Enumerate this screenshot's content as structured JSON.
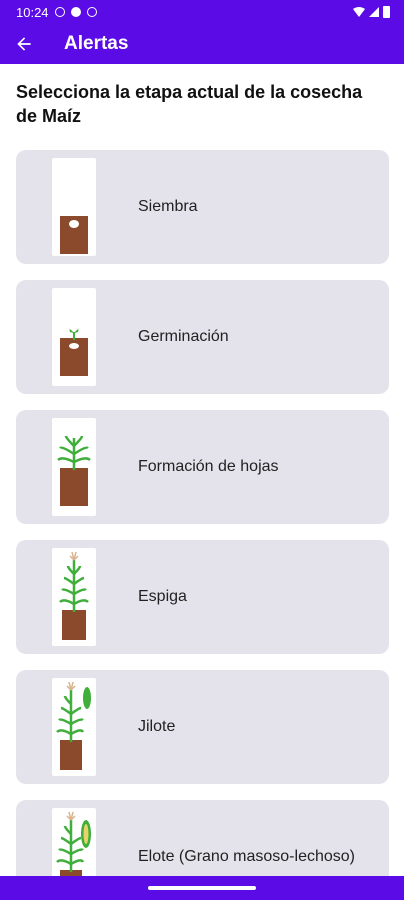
{
  "status_bar": {
    "time": "10:24"
  },
  "app_bar": {
    "title": "Alertas"
  },
  "heading": "Selecciona la etapa actual de la cosecha de Maíz",
  "stages": [
    {
      "label": "Siembra",
      "icon": "seed-pot-icon"
    },
    {
      "label": "Germinación",
      "icon": "sprout-pot-icon"
    },
    {
      "label": "Formación de hojas",
      "icon": "leaves-pot-icon"
    },
    {
      "label": "Espiga",
      "icon": "tassel-plant-icon"
    },
    {
      "label": "Jilote",
      "icon": "silk-plant-icon"
    },
    {
      "label": "Elote (Grano masoso-lechoso)",
      "icon": "corn-plant-icon"
    }
  ],
  "colors": {
    "primary": "#5b0ce6",
    "card_bg": "#e4e3ec",
    "soil": "#8b4a2b",
    "leaf": "#3fae3a"
  }
}
